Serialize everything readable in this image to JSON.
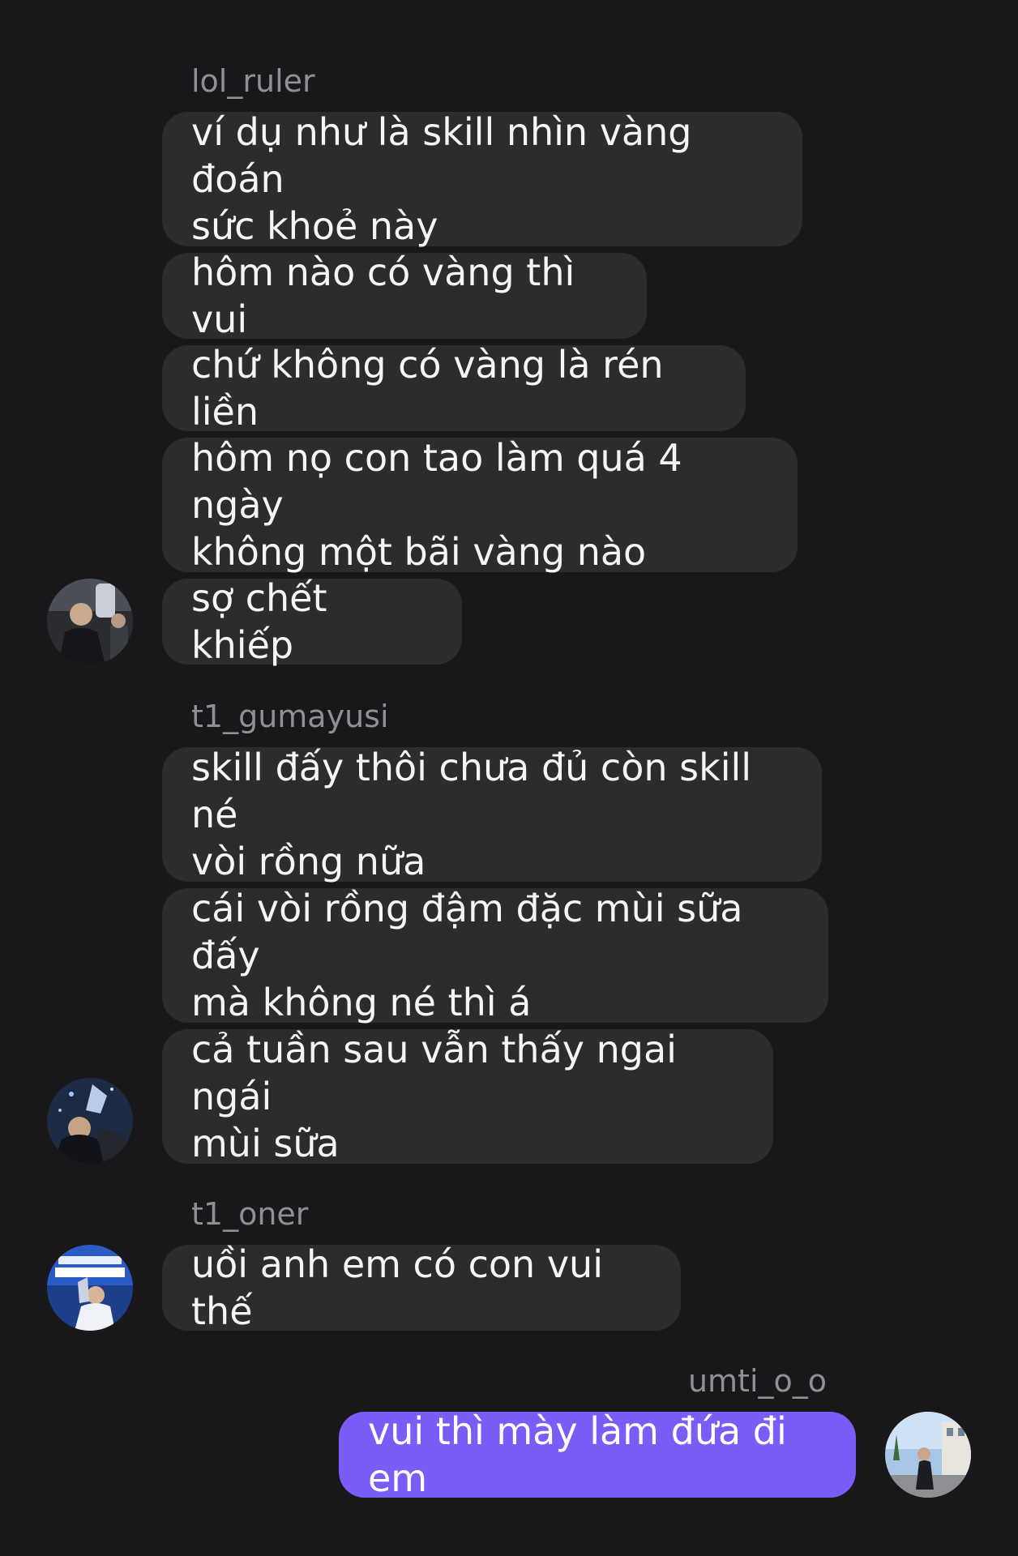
{
  "conversation": {
    "groups": [
      {
        "sender": "lol_ruler",
        "avatar_icon": "user-avatar-icon",
        "messages": [
          "ví dụ như là skill nhìn vàng đoán\nsức khoẻ này",
          "hôm nào có vàng thì vui",
          "chứ không có vàng là rén liền",
          "hôm nọ con tao làm quá 4 ngày\nkhông một bãi vàng nào",
          "sợ chết khiếp"
        ]
      },
      {
        "sender": "t1_gumayusi",
        "avatar_icon": "user-avatar-icon",
        "messages": [
          "skill đấy thôi chưa đủ còn skill né\nvòi rồng nữa",
          "cái vòi rồng đậm đặc mùi sữa đấy\nmà không né thì á",
          "cả tuần sau vẫn thấy ngai ngái\nmùi sữa"
        ]
      },
      {
        "sender": "t1_oner",
        "avatar_icon": "user-avatar-icon",
        "messages": [
          "uồi anh em có con vui thế"
        ]
      },
      {
        "sender": "umti_o_o",
        "avatar_icon": "user-avatar-icon",
        "own": true,
        "messages": [
          "vui thì mày làm đứa đi em"
        ]
      }
    ]
  },
  "colors": {
    "background": "#18181a",
    "incoming_bubble": "#2c2c2e",
    "outgoing_bubble": "#7c5cf7",
    "sender_name": "#8f8f94"
  }
}
